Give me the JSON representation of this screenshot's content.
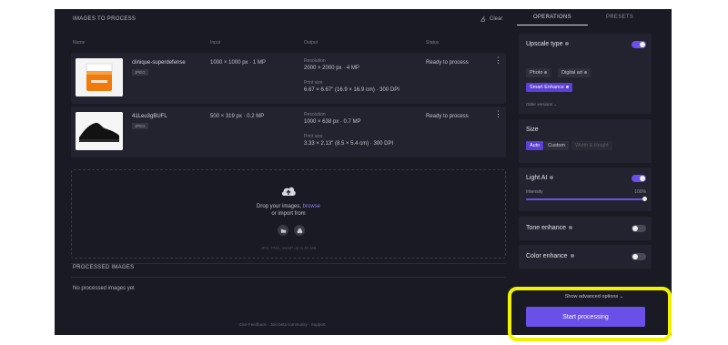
{
  "left": {
    "title": "IMAGES TO PROCESS",
    "clear_label": "Clear",
    "columns": [
      "Name",
      "Input",
      "Output",
      "Status"
    ],
    "images": [
      {
        "name": "clinique-superdefense",
        "format": "JPEG",
        "input": "1000 × 1000 px · 1 MP",
        "resolution_label": "Resolution",
        "resolution": "2000 × 2000 px · 4 MP",
        "print_label": "Print size",
        "print_size": "6.67 × 6.67\" (16.9 × 16.9 cm) · 300 DPI",
        "status": "Ready to process"
      },
      {
        "name": "41Leu3gBUFL",
        "format": "JPEG",
        "input": "500 × 319 px · 0.2 MP",
        "resolution_label": "Resolution",
        "resolution": "1000 × 638 px · 0.7 MP",
        "print_label": "Print size",
        "print_size": "3.33 × 2.13\" (8.5 × 5.4 cm) · 300 DPI",
        "status": "Ready to process"
      }
    ],
    "dropzone": {
      "line1_prefix": "Drop your images, ",
      "browse": "browse",
      "line2": "or import from",
      "formats": "JPG, PNG, WebP up to 50 MB"
    },
    "processed_title": "PROCESSED IMAGES",
    "processed_empty": "No processed images yet",
    "footer": "Give Feedback  ·  Join beta community  ·  Support"
  },
  "right": {
    "tabs": [
      "OPERATIONS",
      "PRESETS"
    ],
    "upscale": {
      "title": "Upscale type",
      "enabled": true,
      "options": [
        "Photo",
        "Digital art",
        "Smart Enhance"
      ],
      "selected": "Smart Enhance",
      "older_versions": "Older versions"
    },
    "size": {
      "title": "Size",
      "options": [
        "Auto",
        "Custom",
        "Width & Height"
      ],
      "selected": "Auto"
    },
    "light_ai": {
      "title": "Light AI",
      "enabled": true,
      "intensity_label": "Intensity",
      "intensity_value": "100%",
      "intensity_fraction": 1.0
    },
    "tone_enhance": {
      "title": "Tone enhance",
      "enabled": false
    },
    "color_enhance": {
      "title": "Color enhance",
      "enabled": false
    },
    "advanced_label": "Show advanced options",
    "start_label": "Start processing"
  },
  "colors": {
    "accent": "#6a4fe8",
    "highlight": "#f2f200",
    "panel": "#1a1a24"
  }
}
